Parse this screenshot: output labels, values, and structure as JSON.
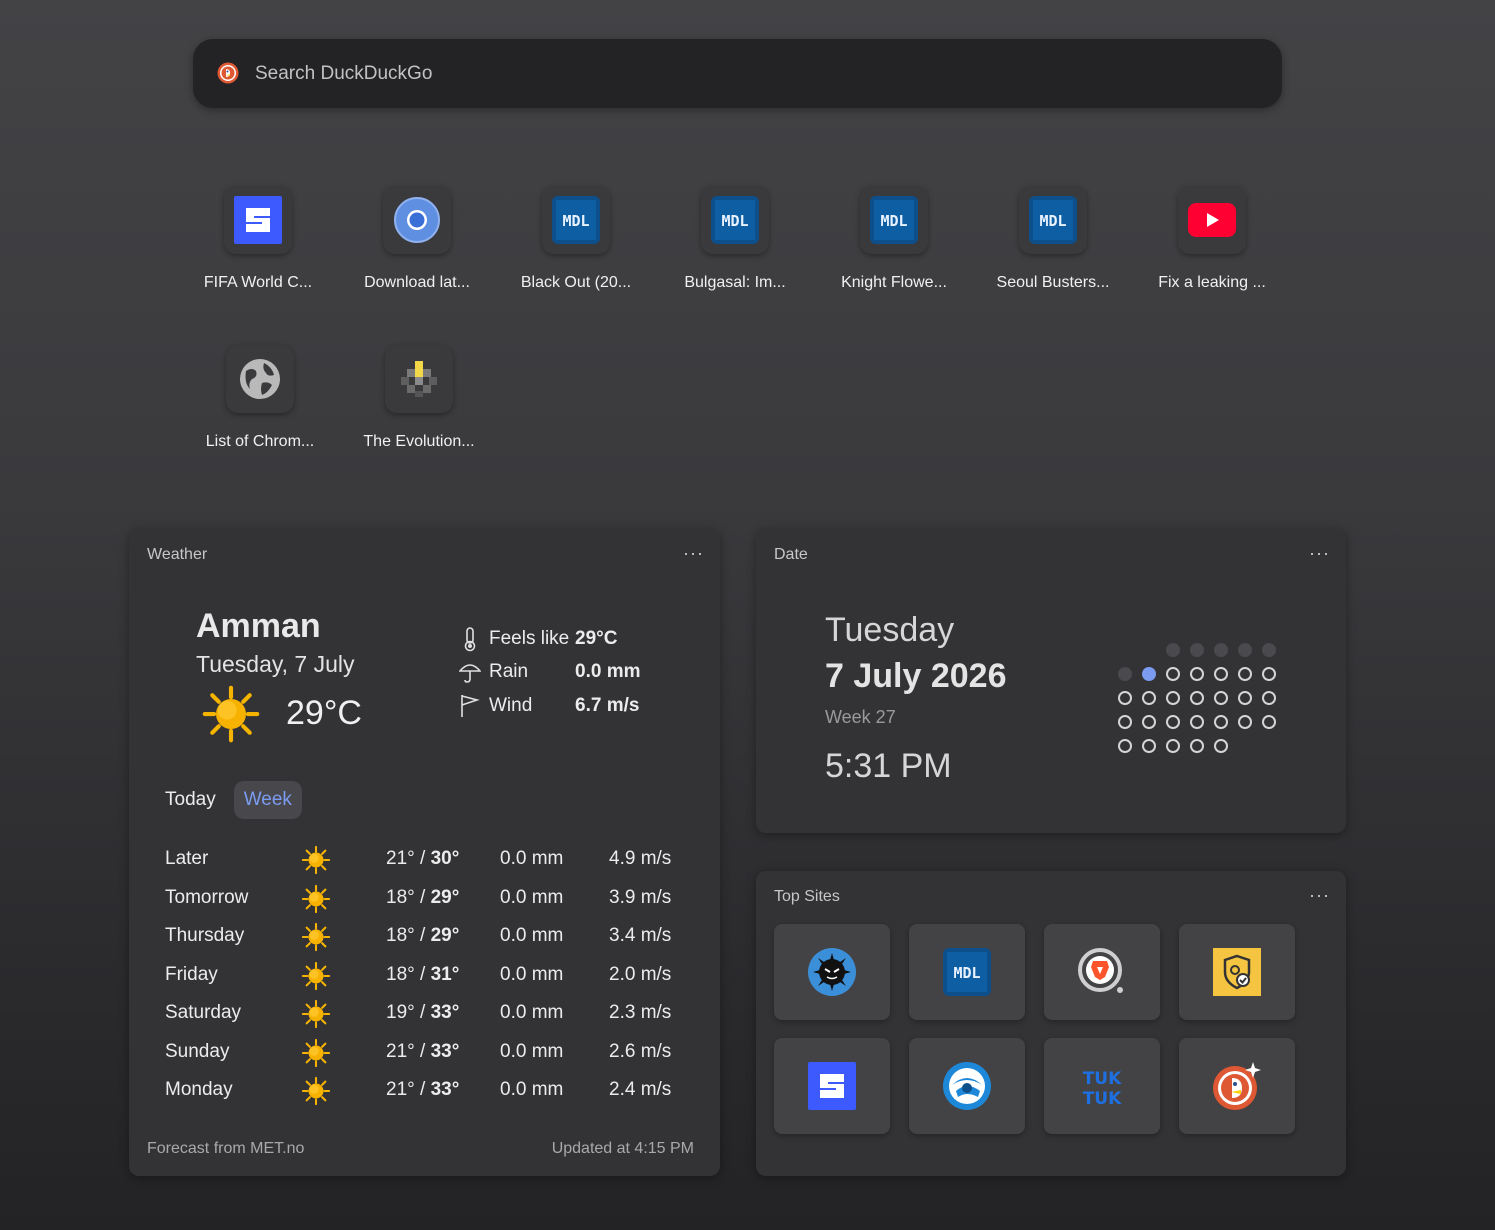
{
  "search": {
    "placeholder": "Search DuckDuckGo",
    "logo_icon": "duckduckgo-logo-icon"
  },
  "shortcuts": [
    {
      "label": "FIFA World C...",
      "icon": "blue-s-logo-icon"
    },
    {
      "label": "Download lat...",
      "icon": "chromium-logo-icon"
    },
    {
      "label": "Black Out (20...",
      "icon": "mdl-logo-icon"
    },
    {
      "label": "Bulgasal: Im...",
      "icon": "mdl-logo-icon"
    },
    {
      "label": "Knight Flowe...",
      "icon": "mdl-logo-icon"
    },
    {
      "label": "Seoul Busters...",
      "icon": "mdl-logo-icon"
    },
    {
      "label": "Fix a leaking ...",
      "icon": "youtube-logo-icon"
    },
    {
      "label": "List of Chrom...",
      "icon": "globe-icon"
    },
    {
      "label": "The Evolution...",
      "icon": "diamond-pixel-icon"
    }
  ],
  "weather": {
    "title": "Weather",
    "menu": "···",
    "city": "Amman",
    "date": "Tuesday, 7 July",
    "temp": "29°C",
    "feels_label": "Feels like",
    "feels_value": "29°C",
    "rain_label": "Rain",
    "rain_value": "0.0 mm",
    "wind_label": "Wind",
    "wind_value": "6.7 m/s",
    "tab_today": "Today",
    "tab_week": "Week",
    "forecast": [
      {
        "day": "Later",
        "low": "21°",
        "high": "30°",
        "rain": "0.0 mm",
        "wind": "4.9 m/s"
      },
      {
        "day": "Tomorrow",
        "low": "18°",
        "high": "29°",
        "rain": "0.0 mm",
        "wind": "3.9 m/s"
      },
      {
        "day": "Thursday",
        "low": "18°",
        "high": "29°",
        "rain": "0.0 mm",
        "wind": "3.4 m/s"
      },
      {
        "day": "Friday",
        "low": "18°",
        "high": "31°",
        "rain": "0.0 mm",
        "wind": "2.0 m/s"
      },
      {
        "day": "Saturday",
        "low": "19°",
        "high": "33°",
        "rain": "0.0 mm",
        "wind": "2.3 m/s"
      },
      {
        "day": "Sunday",
        "low": "21°",
        "high": "33°",
        "rain": "0.0 mm",
        "wind": "2.6 m/s"
      },
      {
        "day": "Monday",
        "low": "21°",
        "high": "33°",
        "rain": "0.0 mm",
        "wind": "2.4 m/s"
      }
    ],
    "footer_source": "Forecast from MET.no",
    "footer_updated": "Updated at 4:15 PM"
  },
  "date_widget": {
    "title": "Date",
    "menu": "···",
    "weekday": "Tuesday",
    "full_date": "7 July 2026",
    "week": "Week 27",
    "time": "5:31 PM"
  },
  "top_sites": {
    "title": "Top Sites",
    "menu": "···",
    "sites": [
      {
        "icon": "dark-virus-logo-icon"
      },
      {
        "icon": "mdl-logo-icon"
      },
      {
        "icon": "brave-search-logo-icon"
      },
      {
        "icon": "shield-check-logo-icon"
      },
      {
        "icon": "blue-s-logo-icon"
      },
      {
        "icon": "blue-globe-logo-icon"
      },
      {
        "icon": "tuktuk-logo-icon"
      },
      {
        "icon": "duckduckgo-ai-logo-icon"
      }
    ]
  },
  "colors": {
    "accent": "#7b9bf0",
    "background": "#3a3a3d",
    "card": "#333336"
  }
}
